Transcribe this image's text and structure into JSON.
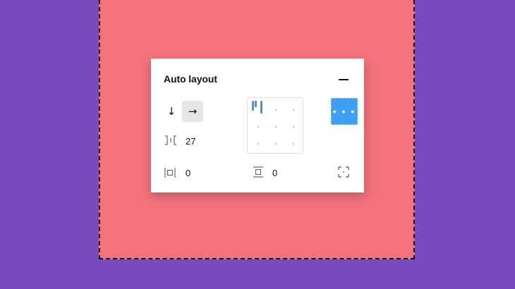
{
  "panel": {
    "title": "Auto layout",
    "collapse_icon": "minus-icon",
    "direction": {
      "down_icon": "↓",
      "right_icon": "→",
      "selected": "horizontal"
    },
    "spacing": {
      "icon": "item-spacing-icon",
      "value": "27"
    },
    "padding": {
      "icon": "padding-icon",
      "value": "0"
    },
    "padding_vertical": {
      "icon": "vertical-padding-icon",
      "value": "0"
    },
    "alignment": {
      "icon": "alignment-grid-icon",
      "selected": "top-left"
    },
    "more": {
      "label": "• • •"
    },
    "resize": {
      "icon": "resizing-icon"
    }
  },
  "colors": {
    "background": "#7a4bbd",
    "frame": "#f4727e",
    "accent": "#3ea0f2"
  }
}
